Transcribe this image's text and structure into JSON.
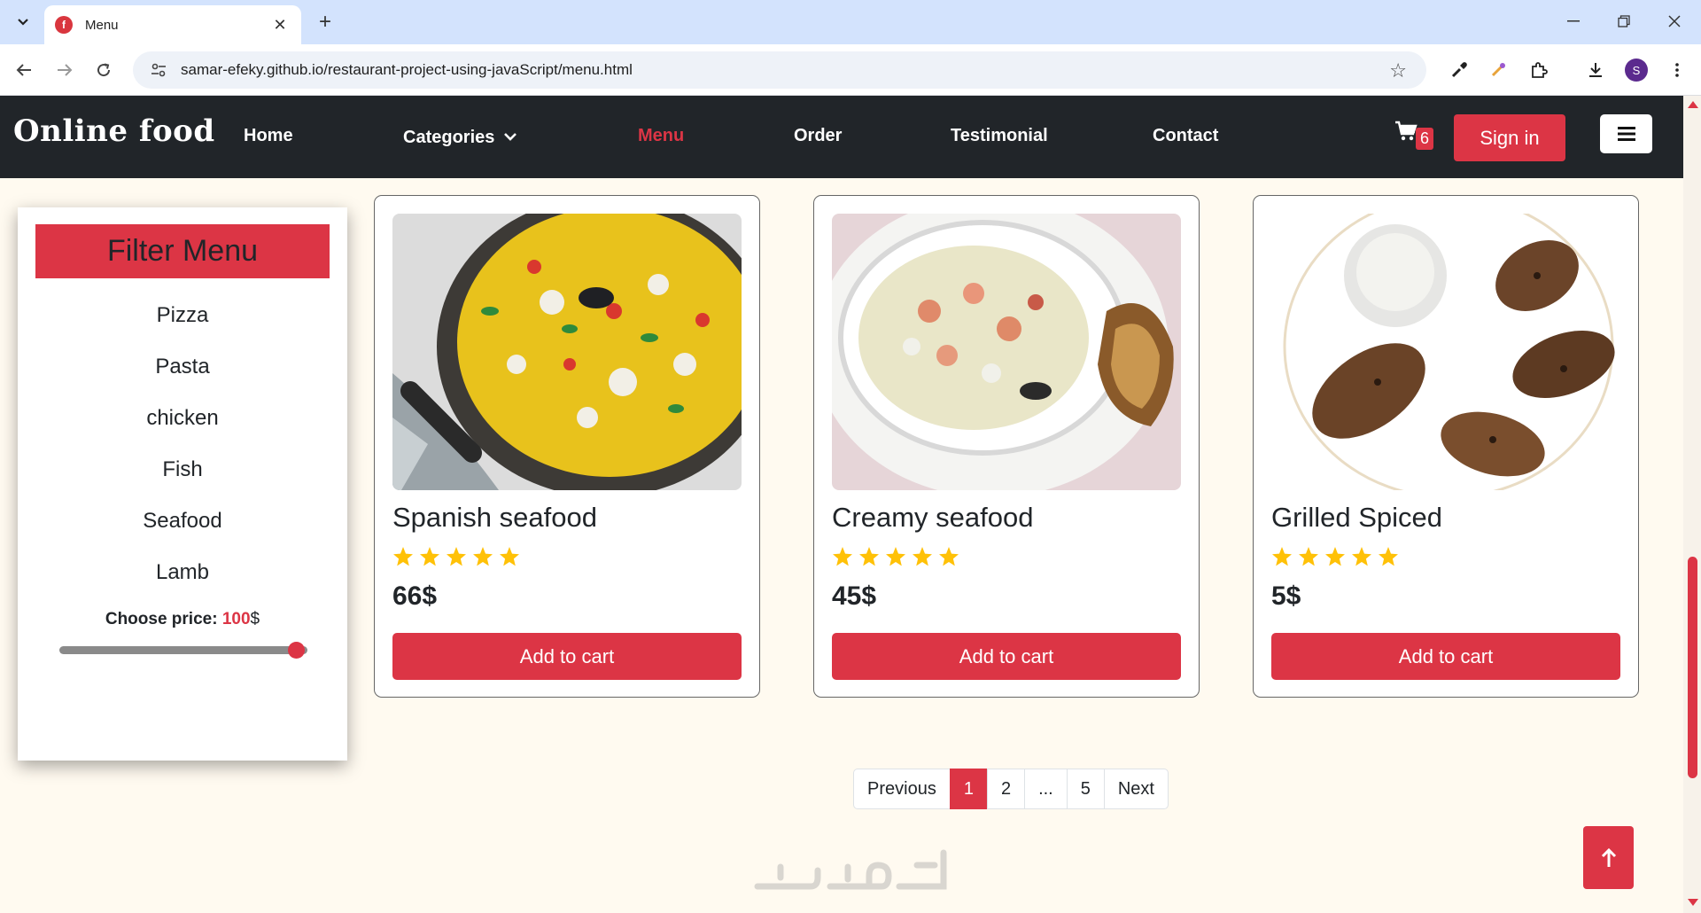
{
  "browser": {
    "tab_title": "Menu",
    "url": "samar-efeky.github.io/restaurant-project-using-javaScript/menu.html",
    "profile_initial": "S"
  },
  "navbar": {
    "brand": "Online food",
    "links": [
      "Home",
      "Categories",
      "Menu",
      "Order",
      "Testimonial",
      "Contact"
    ],
    "active": "Menu",
    "cart_count": "6",
    "signin_label": "Sign in"
  },
  "filter": {
    "title": "Filter Menu",
    "items": [
      "Pizza",
      "Pasta",
      "chicken",
      "Fish",
      "Seafood",
      "Lamb"
    ],
    "price_label": "Choose price:",
    "price_value": "100",
    "price_unit": "$",
    "slider_level": 1.0
  },
  "cards": [
    {
      "title": "Spanish seafood",
      "rating": 5,
      "price": "66$",
      "button": "Add to cart"
    },
    {
      "title": "Creamy seafood",
      "rating": 5,
      "price": "45$",
      "button": "Add to cart"
    },
    {
      "title": "Grilled Spiced",
      "rating": 5,
      "price": "5$",
      "button": "Add to cart"
    }
  ],
  "pagination": {
    "items": [
      "Previous",
      "1",
      "2",
      "...",
      "5",
      "Next"
    ],
    "active": "1"
  },
  "colors": {
    "accent": "#dc3545",
    "navbar_bg": "#212529",
    "page_bg": "#fffaf0",
    "star": "#ffc107"
  }
}
